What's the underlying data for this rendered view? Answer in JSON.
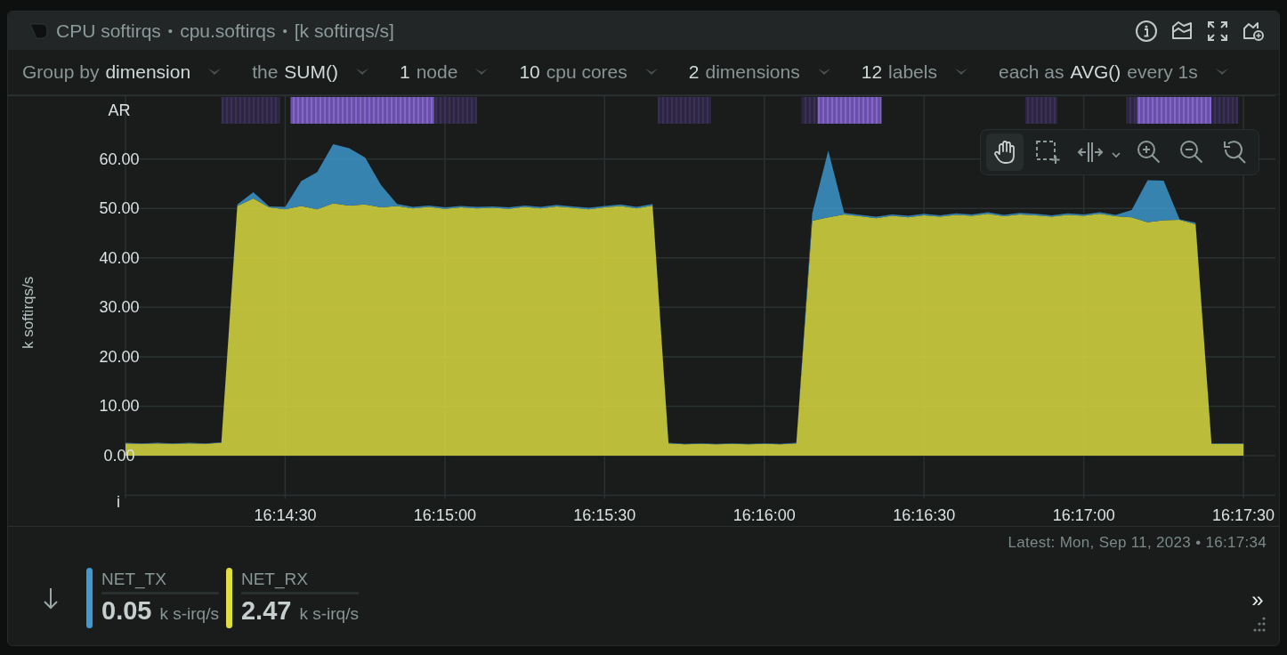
{
  "header": {
    "parts": [
      {
        "kind": "title",
        "text": "CPU softirqs"
      },
      {
        "kind": "separator",
        "text": "•"
      },
      {
        "kind": "context",
        "text": "cpu.softirqs"
      },
      {
        "kind": "separator",
        "text": "•"
      },
      {
        "kind": "units",
        "text": "[k softirqs/s]"
      }
    ]
  },
  "filters": [
    {
      "segments": [
        {
          "text": "Group by",
          "strong": false
        },
        {
          "text": "dimension",
          "strong": true
        }
      ]
    },
    {
      "segments": [
        {
          "text": "the",
          "strong": false
        },
        {
          "text": "SUM()",
          "strong": true
        }
      ]
    },
    {
      "segments": [
        {
          "text": "1",
          "strong": true
        },
        {
          "text": "node",
          "strong": false
        }
      ]
    },
    {
      "segments": [
        {
          "text": "10",
          "strong": true
        },
        {
          "text": "cpu cores",
          "strong": false
        }
      ]
    },
    {
      "segments": [
        {
          "text": "2",
          "strong": true
        },
        {
          "text": "dimensions",
          "strong": false
        }
      ]
    },
    {
      "segments": [
        {
          "text": "12",
          "strong": true
        },
        {
          "text": "labels",
          "strong": false
        }
      ]
    },
    {
      "segments": [
        {
          "text": "each as",
          "strong": false
        },
        {
          "text": "AVG()",
          "strong": true
        },
        {
          "text": "every 1s",
          "strong": false
        }
      ]
    }
  ],
  "chart": {
    "top_band_label": "AR",
    "bottom_band_label": "i",
    "tools": [
      {
        "kind": "pan",
        "selected": true
      },
      {
        "kind": "select",
        "selected": false
      },
      {
        "kind": "highlight",
        "selected": false
      },
      {
        "kind": "zoom_in",
        "selected": false
      },
      {
        "kind": "zoom_out",
        "selected": false
      },
      {
        "kind": "reset",
        "selected": false
      }
    ],
    "chart_data": {
      "type": "area",
      "stacked": true,
      "ylabel": "k softirqs/s",
      "categories": [
        null,
        null,
        null,
        null,
        null,
        null,
        null,
        null,
        null,
        null,
        "16:14:30",
        null,
        null,
        null,
        null,
        null,
        null,
        null,
        null,
        null,
        "16:15:00",
        null,
        null,
        null,
        null,
        null,
        null,
        null,
        null,
        null,
        "16:15:30",
        null,
        null,
        null,
        null,
        null,
        null,
        null,
        null,
        null,
        "16:16:00",
        null,
        null,
        null,
        null,
        null,
        null,
        null,
        null,
        null,
        "16:16:30",
        null,
        null,
        null,
        null,
        null,
        null,
        null,
        null,
        null,
        "16:17:00",
        null,
        null,
        null,
        null,
        null,
        null,
        null,
        null,
        null,
        "16:17:30"
      ],
      "series": [
        {
          "name": "NET_TX",
          "color": "#3e9ad0",
          "values": [
            0.1,
            0.1,
            0.1,
            0.1,
            0.1,
            0.1,
            0.1,
            0.3,
            1.3,
            0.2,
            0.5,
            5.0,
            7.5,
            12.0,
            11.6,
            9.5,
            4.5,
            0.4,
            0.3,
            0.3,
            0.3,
            0.3,
            0.3,
            0.3,
            0.3,
            0.3,
            0.3,
            0.3,
            0.3,
            0.3,
            0.3,
            0.3,
            0.3,
            0.3,
            0.1,
            0.1,
            0.1,
            0.1,
            0.1,
            0.1,
            0.1,
            0.1,
            0.1,
            1.5,
            13.5,
            0.3,
            0.3,
            0.3,
            0.3,
            0.3,
            0.3,
            0.3,
            0.3,
            0.3,
            0.3,
            0.3,
            0.3,
            0.3,
            0.3,
            0.3,
            0.3,
            0.3,
            0.3,
            1.5,
            8.5,
            8.0,
            0.1,
            0.3,
            0.1,
            0.1,
            0.1
          ]
        },
        {
          "name": "NET_RX",
          "color": "#dfdf3f",
          "values": [
            2.5,
            2.4,
            2.5,
            2.4,
            2.5,
            2.4,
            2.6,
            50.5,
            52.0,
            50.2,
            49.8,
            50.5,
            49.8,
            51.0,
            50.6,
            50.8,
            50.2,
            50.5,
            50.0,
            50.3,
            49.9,
            50.2,
            50.0,
            50.1,
            49.9,
            50.3,
            50.0,
            50.4,
            50.1,
            49.8,
            50.2,
            50.5,
            50.0,
            50.6,
            2.5,
            2.3,
            2.4,
            2.3,
            2.4,
            2.3,
            2.4,
            2.3,
            2.5,
            47.5,
            48.2,
            48.8,
            48.4,
            48.0,
            48.5,
            48.2,
            48.6,
            48.3,
            48.7,
            48.5,
            48.9,
            48.4,
            48.8,
            48.6,
            48.3,
            48.7,
            48.5,
            48.9,
            48.4,
            48.2,
            47.2,
            47.6,
            47.7,
            46.8,
            2.4,
            2.4,
            2.4
          ]
        }
      ],
      "ylim": [
        -8,
        72.8
      ],
      "grid": true,
      "yticks": [
        {
          "value": 0,
          "label": "0.00"
        },
        {
          "value": 10,
          "label": "10.00"
        },
        {
          "value": 20,
          "label": "20.00"
        },
        {
          "value": 30,
          "label": "30.00"
        },
        {
          "value": 40,
          "label": "40.00"
        },
        {
          "value": 50,
          "label": "50.00"
        },
        {
          "value": 60,
          "label": "60.00"
        }
      ]
    }
  },
  "latest": "Latest: Mon, Sep 11, 2023 • 16:17:34",
  "legend": [
    {
      "value": "0.05",
      "unit": "k s-irq/s"
    },
    {
      "value": "2.47",
      "unit": "k s-irq/s"
    }
  ],
  "expand_label": "»"
}
